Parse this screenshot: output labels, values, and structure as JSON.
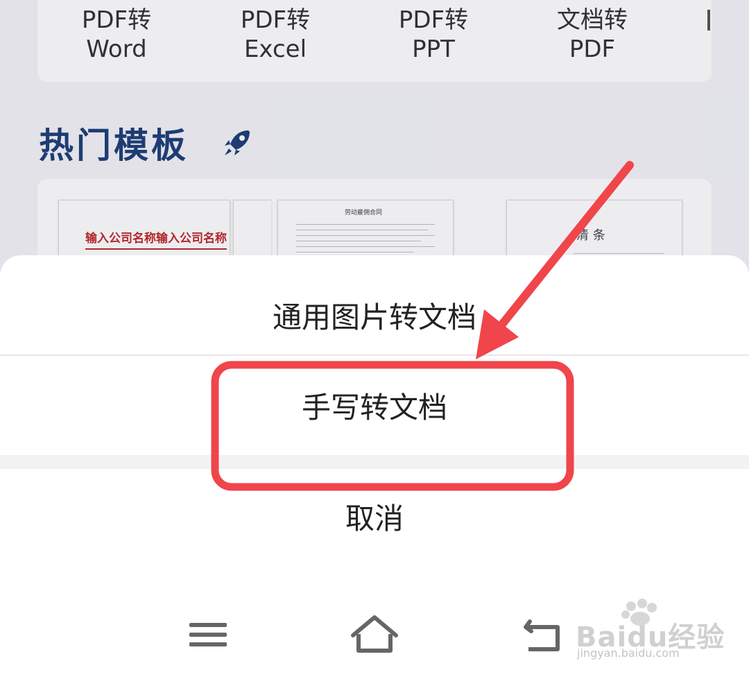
{
  "tools": [
    {
      "line1": "PDF转",
      "line2": "Word"
    },
    {
      "line1": "PDF转",
      "line2": "Excel"
    },
    {
      "line1": "PDF转",
      "line2": "PPT"
    },
    {
      "line1": "文档转",
      "line2": "PDF"
    }
  ],
  "section_title": "热门模板",
  "templates": {
    "t1_title": "输入公司名称输入公司名称",
    "t2_title": "劳动雇佣合同",
    "t3_heading": "清 条"
  },
  "sheet": {
    "option_general": "通用图片转文档",
    "option_handwriting": "手写转文档",
    "cancel": "取消"
  },
  "highlight_color": "#f0454b",
  "watermark": {
    "brand": "Baidu经验",
    "url": "jingyan.baidu.com"
  }
}
